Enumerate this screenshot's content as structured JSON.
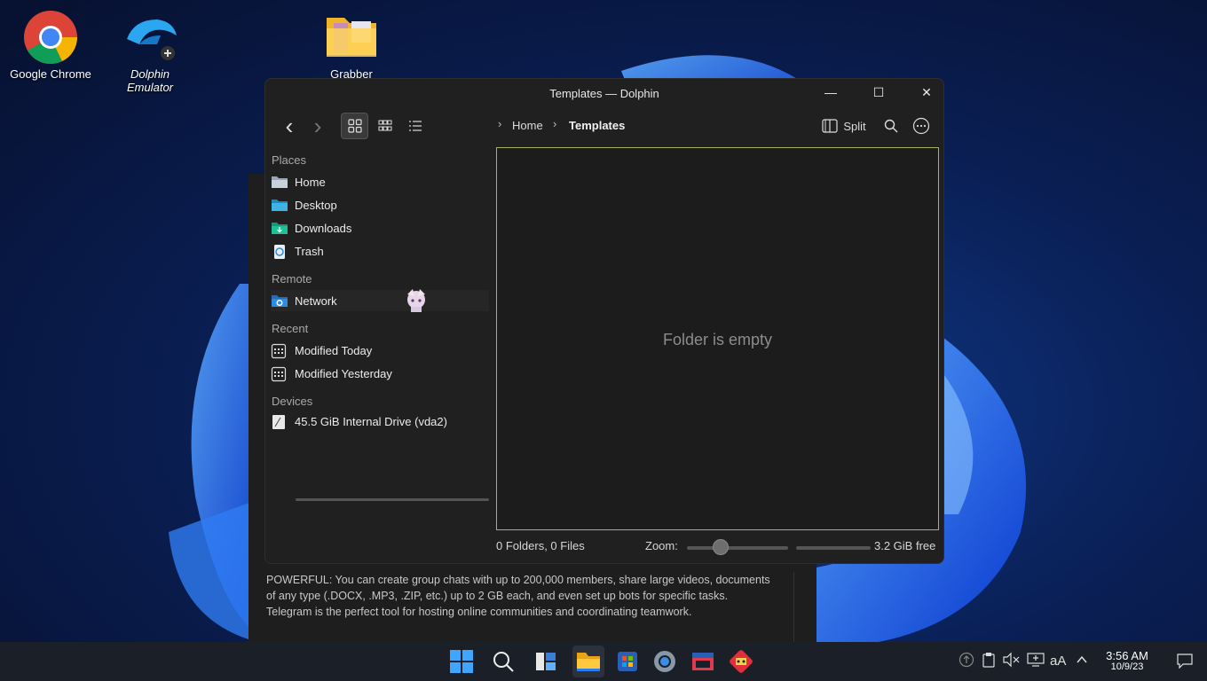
{
  "desktop": {
    "icons": [
      {
        "label": "Google Chrome",
        "icon": "chrome-icon"
      },
      {
        "label": "Dolphin",
        "label2": "Emulator",
        "icon": "dolphin-emulator-icon"
      },
      {
        "label": "Grabber",
        "icon": "folder-icon"
      }
    ]
  },
  "telegram_bg": {
    "description": "POWERFUL: You can create group chats with up to 200,000 members, share large videos, documents of any type (.DOCX, .MP3, .ZIP, etc.) up to 2 GB each, and even set up bots for specific tasks. Telegram is the perfect tool for hosting online communities and coordinating teamwork."
  },
  "window": {
    "title": "Templates — Dolphin",
    "controls": {
      "minimize": "—",
      "maximize": "☐",
      "close": "✕"
    }
  },
  "toolbar": {
    "back": "‹",
    "forward": "›",
    "breadcrumb": [
      "Home",
      "Templates"
    ],
    "split_label": "Split",
    "view_modes": [
      "icons",
      "compact",
      "details"
    ],
    "active_view": "icons"
  },
  "places": {
    "sections": [
      {
        "title": "Places",
        "items": [
          {
            "label": "Home",
            "icon": "home-folder-icon"
          },
          {
            "label": "Desktop",
            "icon": "desktop-folder-icon"
          },
          {
            "label": "Downloads",
            "icon": "downloads-folder-icon"
          },
          {
            "label": "Trash",
            "icon": "trash-icon"
          }
        ]
      },
      {
        "title": "Remote",
        "items": [
          {
            "label": "Network",
            "icon": "network-folder-icon"
          }
        ]
      },
      {
        "title": "Recent",
        "items": [
          {
            "label": "Modified Today",
            "icon": "calendar-icon"
          },
          {
            "label": "Modified Yesterday",
            "icon": "calendar-icon"
          }
        ]
      },
      {
        "title": "Devices",
        "items": [
          {
            "label": "45.5 GiB Internal Drive (vda2)",
            "icon": "drive-icon"
          }
        ]
      }
    ]
  },
  "content": {
    "empty_message": "Folder is empty"
  },
  "statusbar": {
    "counts": "0 Folders, 0 Files",
    "zoom_label": "Zoom:",
    "free_space": "3.2 GiB free",
    "zoom_level": 0.3
  },
  "taskbar": {
    "apps": [
      "start-icon",
      "search-icon",
      "widgets-icon",
      "file-explorer-icon",
      "app-store-icon",
      "settings-icon",
      "media-icon",
      "game-icon"
    ],
    "active_app": "file-explorer-icon",
    "tray": {
      "font_label": "aA"
    },
    "clock": {
      "time": "3:56 AM",
      "date": "10/9/23"
    }
  },
  "colors": {
    "window_bg": "#202020",
    "content_border": "#a8b35a",
    "accent": "#3a8ee6"
  }
}
